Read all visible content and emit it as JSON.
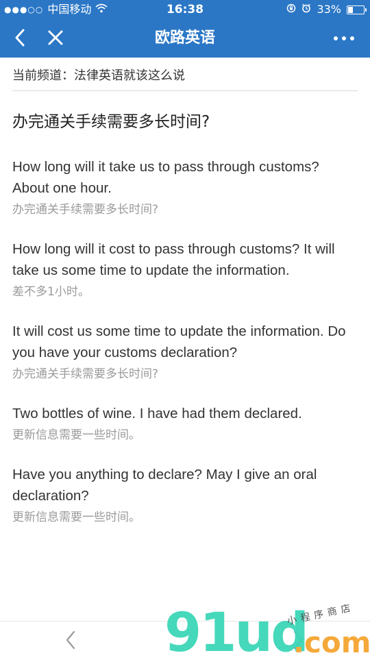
{
  "status_bar": {
    "signal": "●●●○○",
    "carrier": "中国移动",
    "wifi_icon": "wifi-icon",
    "time": "16:38",
    "battery": "33%",
    "battery_level": 0.33
  },
  "nav": {
    "title": "欧路英语",
    "back_icon": "back-arrow-icon",
    "close_icon": "close-icon",
    "more_icon": "more-icon"
  },
  "channel": {
    "label": "当前频道：法律英语就该这么说"
  },
  "page": {
    "heading": "办完通关手续需要多长时间?"
  },
  "items": [
    {
      "en": "How long will it take us to pass through customs? About one hour.",
      "zh": "办完通关手续需要多长时间?"
    },
    {
      "en": "How long will it cost to pass through customs? It will take us some time to update the information.",
      "zh": "差不多1小时。"
    },
    {
      "en": "It will cost us some time to update the information. Do you have your customs declaration?",
      "zh": "办完通关手续需要多长时间?"
    },
    {
      "en": "Two bottles of wine. I have had them declared.",
      "zh": "更新信息需要一些时间。"
    },
    {
      "en": "Have you anything to declare? May I give an oral declaration?",
      "zh": "更新信息需要一些时间。"
    }
  ],
  "watermark": {
    "logo": "91ud",
    "suffix": ".com",
    "tagline": "小程序商店"
  },
  "colors": {
    "nav_bg": "#2b77c6",
    "text_main": "#333333",
    "text_sub": "#9a9a9a"
  }
}
